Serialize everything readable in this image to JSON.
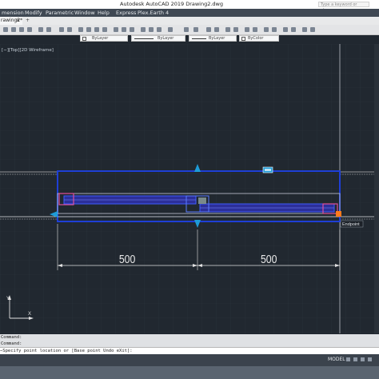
{
  "window": {
    "title": "Autodesk AutoCAD 2019    Drawing2.dwg",
    "search_placeholder": "Type a keyword or phrase"
  },
  "menubar": {
    "items": [
      "mension",
      "Modify",
      "Parametric",
      "Window",
      "Help",
      "Express",
      "Plex.Earth 4"
    ]
  },
  "document_tab": {
    "label": "rawing2*",
    "close_glyph": "×",
    "new_tab_glyph": "+"
  },
  "properties": {
    "color": "ByLayer",
    "linetype": "ByLayer",
    "lineweight": "ByLayer",
    "plotstyle": "ByColor"
  },
  "viewport": {
    "label": "[−][Top][2D Wireframe]",
    "dimension_left": "500",
    "dimension_right": "500",
    "osnap_tooltip": "Endpoint",
    "ucs_x": "X",
    "ucs_y": "Y"
  },
  "command": {
    "history": [
      "Command:",
      "Command:"
    ],
    "prompt": "−Specify point location or [Base point Undo eXit]:"
  },
  "statusbar": {
    "model_tab": "MODEL"
  },
  "colors": {
    "background": "#212830",
    "grid": "#2b333c",
    "selection": "#1e3fd6",
    "grip": "#1e9bd7"
  }
}
